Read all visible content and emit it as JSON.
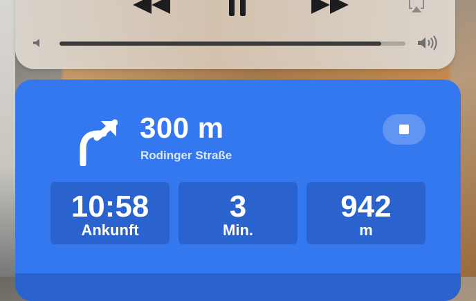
{
  "media": {
    "controls": {
      "rewind_icon": "rewind-icon",
      "pause_icon": "pause-icon",
      "forward_icon": "fast-forward-icon",
      "airplay_icon": "airplay-icon"
    },
    "volume": {
      "level": 0.93,
      "low_icon": "speaker-low-icon",
      "high_icon": "speaker-high-icon"
    }
  },
  "navigation": {
    "maneuver_icon": "turn-right-arrow-icon",
    "distance": "300 m",
    "street": "Rodinger Straße",
    "stop_icon": "stop-icon",
    "stats": [
      {
        "value": "10:58",
        "label": "Ankunft"
      },
      {
        "value": "3",
        "label": "Min."
      },
      {
        "value": "942",
        "label": "m"
      }
    ],
    "colors": {
      "card": "#3478f0",
      "tile": "#2a63cd"
    }
  }
}
